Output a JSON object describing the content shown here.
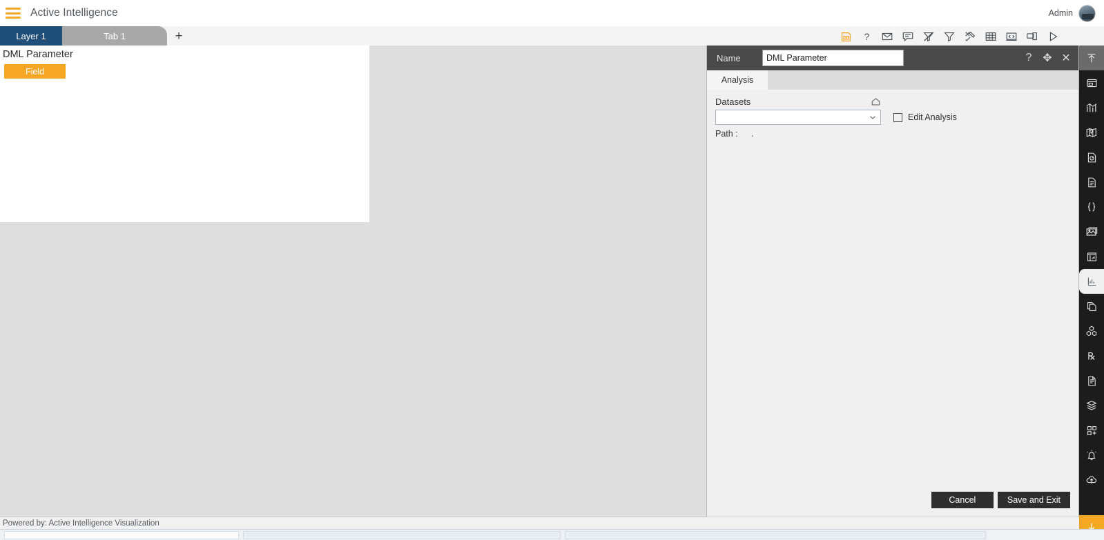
{
  "topbar": {
    "menu_icon": "hamburger-icon",
    "title": "Active Intelligence",
    "user_label": "Admin",
    "avatar_icon": "user-avatar"
  },
  "tabs": {
    "layer_label": "Layer 1",
    "sheet_label": "Tab 1",
    "add_label": "+"
  },
  "canvas": {
    "title": "DML Parameter",
    "field_button": "Field"
  },
  "icon_toolbar": [
    {
      "name": "save-icon",
      "accent": true
    },
    {
      "name": "help-icon",
      "accent": false
    },
    {
      "name": "mail-icon",
      "accent": false
    },
    {
      "name": "comment-icon",
      "accent": false
    },
    {
      "name": "filter-off-icon",
      "accent": false
    },
    {
      "name": "filter-icon",
      "accent": false
    },
    {
      "name": "tools-icon",
      "accent": false
    },
    {
      "name": "table-icon",
      "accent": false
    },
    {
      "name": "code-icon",
      "accent": false
    },
    {
      "name": "duplicate-icon",
      "accent": false
    },
    {
      "name": "play-icon",
      "accent": false
    }
  ],
  "rail": [
    {
      "name": "collapse-up-icon",
      "state": "active-dark"
    },
    {
      "name": "window-icon",
      "state": "normal"
    },
    {
      "name": "chart-icon",
      "state": "normal"
    },
    {
      "name": "map-icon",
      "state": "normal"
    },
    {
      "name": "gauge-doc-icon",
      "state": "normal"
    },
    {
      "name": "document-icon",
      "state": "normal"
    },
    {
      "name": "braces-icon",
      "state": "normal"
    },
    {
      "name": "image-icon",
      "state": "normal"
    },
    {
      "name": "note-table-icon",
      "state": "normal"
    },
    {
      "name": "analysis-icon",
      "state": "active-light"
    },
    {
      "name": "copy-page-icon",
      "state": "normal"
    },
    {
      "name": "cubes-icon",
      "state": "normal"
    },
    {
      "name": "prescription-icon",
      "state": "normal"
    },
    {
      "name": "report-icon",
      "state": "normal"
    },
    {
      "name": "layers-icon",
      "state": "normal"
    },
    {
      "name": "add-widget-icon",
      "state": "normal"
    },
    {
      "name": "alert-bell-icon",
      "state": "normal"
    },
    {
      "name": "cloud-upload-icon",
      "state": "normal"
    },
    {
      "name": "download-icon",
      "state": "accent"
    }
  ],
  "dialog": {
    "name_label": "Name",
    "name_value": "DML Parameter",
    "name_placeholder": "",
    "header_icons": [
      {
        "name": "help-icon",
        "glyph": "?"
      },
      {
        "name": "move-icon",
        "glyph": "✥"
      },
      {
        "name": "close-icon",
        "glyph": "✕"
      }
    ],
    "tabs": [
      {
        "label": "Analysis",
        "active": true
      }
    ],
    "datasets_label": "Datasets",
    "home_icon": "home-icon",
    "dataset_value": "",
    "dataset_placeholder": "",
    "edit_analysis_label": "Edit Analysis",
    "edit_analysis_checked": false,
    "path_label": "Path :",
    "path_value": ".",
    "cancel_label": "Cancel",
    "save_label": "Save and Exit"
  },
  "statusbar": {
    "text": "Powered by: Active Intelligence Visualization"
  },
  "colors": {
    "accent": "#f5a623",
    "layer_tab": "#1f4e79",
    "dialog_header": "#4a4a4a",
    "rail_bg": "#1c1c1c",
    "button_bg": "#2e2e2e"
  }
}
